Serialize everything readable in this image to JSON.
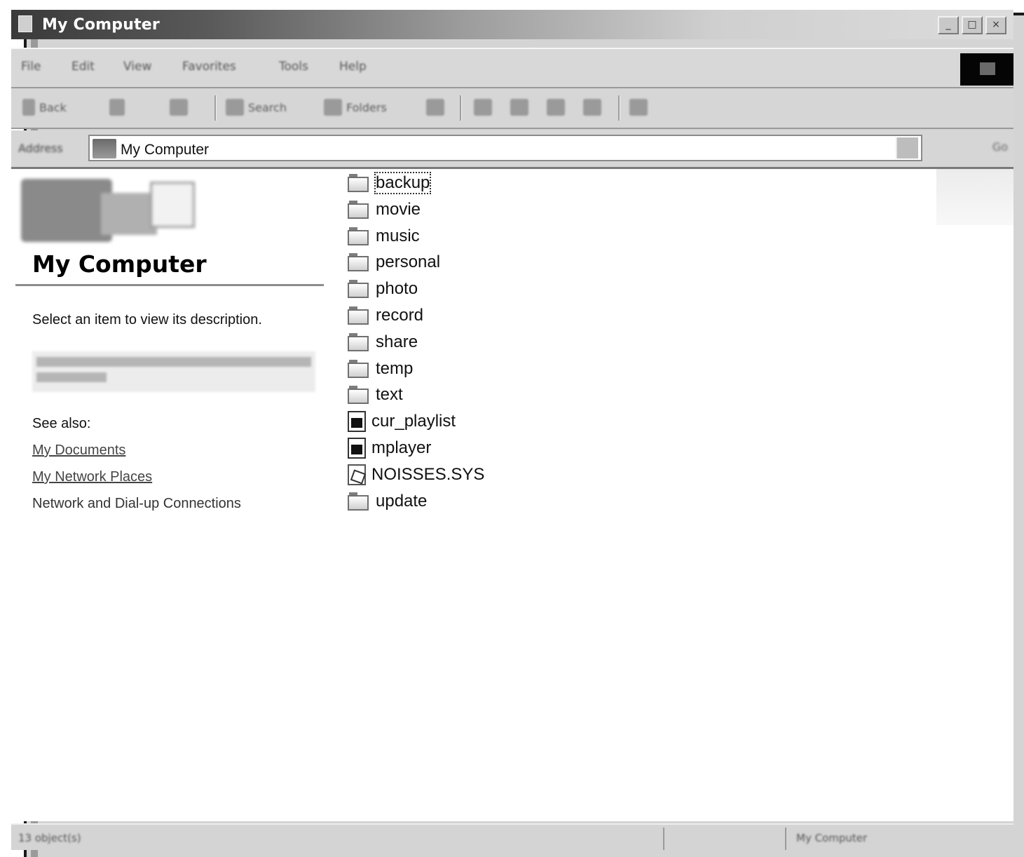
{
  "window": {
    "title": "My Computer",
    "buttons": [
      "_",
      "□",
      "×"
    ]
  },
  "menubar": {
    "items": [
      "File",
      "Edit",
      "View",
      "Favorites",
      "Tools",
      "Help"
    ]
  },
  "toolbar": {
    "back": "Back",
    "forward": "",
    "search": "Search",
    "folders": "Folders",
    "history": ""
  },
  "address": {
    "label": "Address",
    "value": "My Computer",
    "go": "Go"
  },
  "info_pane": {
    "title": "My Computer",
    "description": "Select an item to view its description.",
    "see_also_label": "See also:",
    "links": [
      "My Documents",
      "My Network Places"
    ],
    "extra": "Network and Dial-up Connections"
  },
  "files": [
    {
      "name": "backup",
      "type": "folder",
      "selected": true
    },
    {
      "name": "movie",
      "type": "folder"
    },
    {
      "name": "music",
      "type": "folder"
    },
    {
      "name": "personal",
      "type": "folder"
    },
    {
      "name": "photo",
      "type": "folder"
    },
    {
      "name": "record",
      "type": "folder"
    },
    {
      "name": "share",
      "type": "folder"
    },
    {
      "name": "temp",
      "type": "folder"
    },
    {
      "name": "text",
      "type": "folder"
    },
    {
      "name": "cur_playlist",
      "type": "document"
    },
    {
      "name": "mplayer",
      "type": "document"
    },
    {
      "name": "NOISSES.SYS",
      "type": "system"
    },
    {
      "name": "update",
      "type": "folder"
    }
  ],
  "statusbar": {
    "left": "13 object(s)",
    "right": "My Computer"
  },
  "colors": {
    "chrome": "#d4d4d4",
    "titlebar_dark": "#3a3a3a",
    "content_bg": "#ffffff"
  }
}
